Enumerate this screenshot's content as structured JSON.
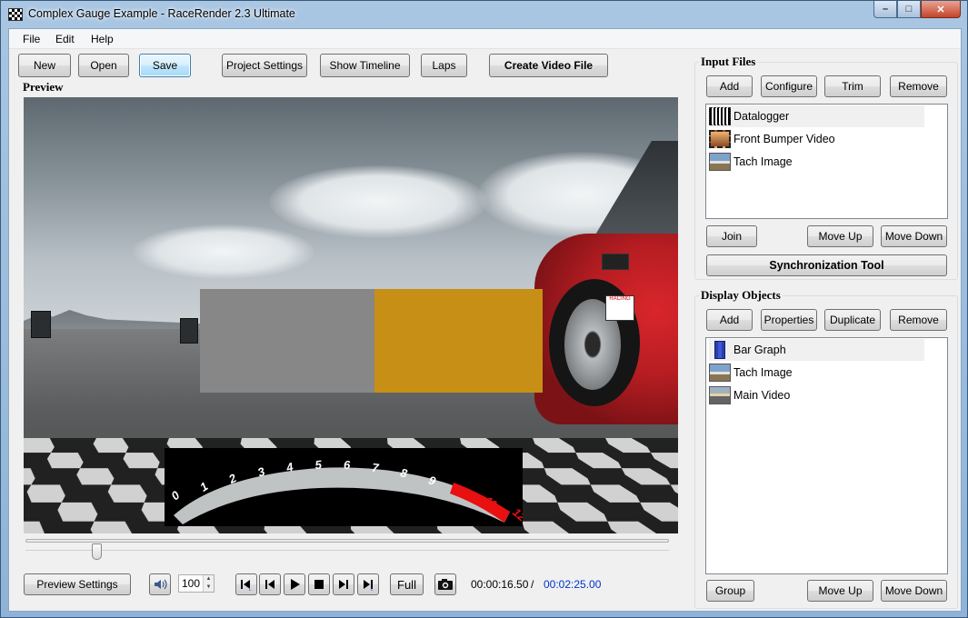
{
  "window": {
    "title": "Complex Gauge Example - RaceRender 2.3 Ultimate",
    "controls": {
      "minimize": "–",
      "maximize": "□",
      "close": "✕"
    }
  },
  "menu": [
    "File",
    "Edit",
    "Help"
  ],
  "toolbar": {
    "new": "New",
    "open": "Open",
    "save": "Save",
    "project_settings": "Project Settings",
    "show_timeline": "Show Timeline",
    "laps": "Laps",
    "create_video": "Create Video File"
  },
  "preview": {
    "label": "Preview",
    "tach_labels": [
      "0",
      "1",
      "2",
      "3",
      "4",
      "5",
      "6",
      "7",
      "8",
      "9",
      "10",
      "11",
      "12"
    ],
    "bar_graph_fill": 0.49,
    "sticker_text": "RACING"
  },
  "playback": {
    "slider_position": 0.11,
    "preview_settings": "Preview Settings",
    "volume": "100",
    "full": "Full",
    "current_time": "00:00:16.50",
    "separator": "/",
    "total_time": "00:02:25.00"
  },
  "input_files": {
    "label": "Input Files",
    "buttons": {
      "add": "Add",
      "configure": "Configure",
      "trim": "Trim",
      "remove": "Remove"
    },
    "items": [
      {
        "label": "Datalogger",
        "icon": "datalogger-icon",
        "selected": true
      },
      {
        "label": "Front Bumper Video",
        "icon": "film-icon",
        "selected": false
      },
      {
        "label": "Tach Image",
        "icon": "image-icon",
        "selected": false
      }
    ],
    "join": "Join",
    "move_up": "Move Up",
    "move_down": "Move Down",
    "sync_tool": "Synchronization Tool"
  },
  "display_objects": {
    "label": "Display Objects",
    "buttons": {
      "add": "Add",
      "properties": "Properties",
      "duplicate": "Duplicate",
      "remove": "Remove"
    },
    "items": [
      {
        "label": "Bar Graph",
        "icon": "bar-graph-icon",
        "selected": true
      },
      {
        "label": "Tach Image",
        "icon": "image-icon",
        "selected": false
      },
      {
        "label": "Main Video",
        "icon": "video-icon",
        "selected": false
      }
    ],
    "group": "Group",
    "move_up": "Move Up",
    "move_down": "Move Down"
  },
  "colors": {
    "bar_gray": "#878787",
    "bar_orange": "#c78f16",
    "tach_redline": "#e81010",
    "time_total": "#0033cc"
  }
}
